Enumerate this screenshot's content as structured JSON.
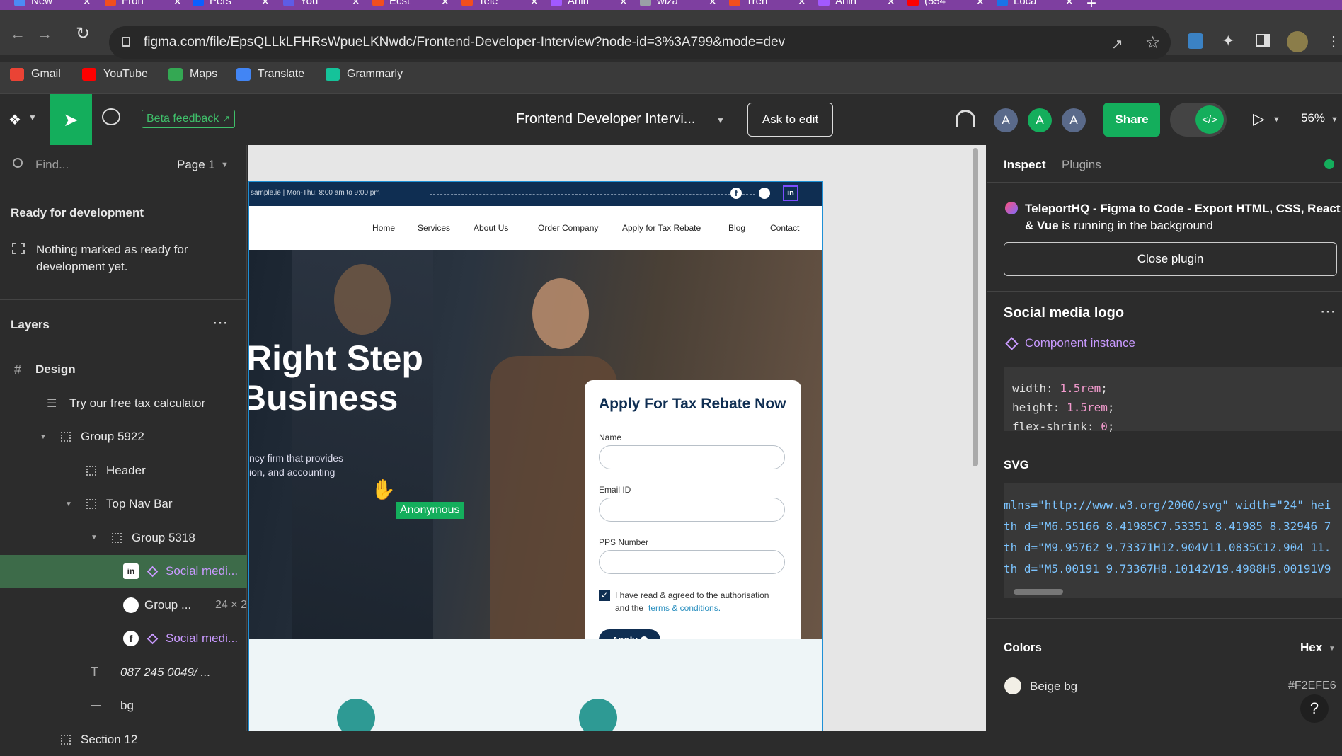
{
  "browser": {
    "tabs": [
      {
        "title": "New",
        "color": "#4c8bf5"
      },
      {
        "title": "Fron",
        "color": "#f24e1e"
      },
      {
        "title": "Pers",
        "color": "#0a5fff"
      },
      {
        "title": "You",
        "color": "#5e5ce6"
      },
      {
        "title": "Ecst",
        "color": "#f24e1e"
      },
      {
        "title": "Tele",
        "color": "#f24e1e"
      },
      {
        "title": "Anin",
        "color": "#a259ff"
      },
      {
        "title": "wiza",
        "color": "#9aa0a6"
      },
      {
        "title": "Tren",
        "color": "#f24e1e"
      },
      {
        "title": "Anin",
        "color": "#a259ff"
      },
      {
        "title": "(554",
        "color": "#ff0000"
      },
      {
        "title": "Loca",
        "color": "#1a73e8"
      }
    ],
    "url": "figma.com/file/EpsQLLkLFHRsWpueLKNwdc/Frontend-Developer-Interview?node-id=3%3A799&mode=dev",
    "bookmarks": [
      {
        "label": "Gmail",
        "color": "#ea4335"
      },
      {
        "label": "YouTube",
        "color": "#ff0000"
      },
      {
        "label": "Maps",
        "color": "#34a853"
      },
      {
        "label": "Translate",
        "color": "#4285f4"
      },
      {
        "label": "Grammarly",
        "color": "#15c39a"
      }
    ]
  },
  "toolbar": {
    "beta_feedback": "Beta feedback",
    "file_title": "Frontend Developer Intervi...",
    "ask_to_edit": "Ask to edit",
    "avatars": [
      {
        "letter": "A",
        "color": "#5a6a8a"
      },
      {
        "letter": "A",
        "color": "#14ae5c"
      },
      {
        "letter": "A",
        "color": "#5a6a8a"
      }
    ],
    "share": "Share",
    "zoom": "56%"
  },
  "left_panel": {
    "find_placeholder": "Find...",
    "page": "Page 1",
    "ready_title": "Ready for development",
    "ready_msg_line1": "Nothing marked as ready for",
    "ready_msg_line2": "development yet.",
    "layers_title": "Layers",
    "layers": [
      {
        "label": "Design",
        "indent": 0
      },
      {
        "label": "Try our free tax calculator",
        "indent": 1
      },
      {
        "label": "Group 5922",
        "indent": 1
      },
      {
        "label": "Header",
        "indent": 2
      },
      {
        "label": "Top Nav Bar",
        "indent": 2
      },
      {
        "label": "Group 5318",
        "indent": 3
      },
      {
        "label": "Social medi...",
        "indent": 4
      },
      {
        "label": "Group ...",
        "indent": 4,
        "extra": "24 × 2..."
      },
      {
        "label": "Social medi...",
        "indent": 4
      },
      {
        "label": "087 245 0049/ ...",
        "indent": 3
      },
      {
        "label": "bg",
        "indent": 3
      },
      {
        "label": "Section 12",
        "indent": 1
      }
    ]
  },
  "canvas": {
    "topbar_text": "sample.ie  |  Mon-Thu: 8:00 am to 9:00 pm",
    "nav_links": [
      "Home",
      "Services",
      "About Us",
      "Order Company",
      "Apply for Tax Rebate",
      "Blog",
      "Contact"
    ],
    "hero_line1": "Right Step",
    "hero_line2": "Business",
    "hero_sub1": "ncy firm that provides",
    "hero_sub2": "ion, and accounting",
    "cursor_label": "Anonymous",
    "form": {
      "title": "Apply For Tax Rebate Now",
      "name_label": "Name",
      "email_label": "Email ID",
      "pps_label": "PPS Number",
      "agree_text1": "I have read & agreed to the authorisation",
      "agree_text2": "and the",
      "agree_link": "terms & conditions.",
      "apply": "Apply"
    }
  },
  "right_panel": {
    "tab_inspect": "Inspect",
    "tab_plugins": "Plugins",
    "plugin_name": "TeleportHQ - Figma to Code - Export HTML, CSS, React",
    "plugin_name2_bold": "& Vue",
    "plugin_name2_rest": " is running in the background",
    "close_plugin": "Close plugin",
    "component_title": "Social media logo",
    "component_kind": "Component instance",
    "css": [
      {
        "prop": "width",
        "val": "1.5rem"
      },
      {
        "prop": "height",
        "val": "1.5rem"
      },
      {
        "prop": "flex-shrink",
        "val": "0"
      }
    ],
    "svg_title": "SVG",
    "svg_lines": [
      "mlns=\"http://www.w3.org/2000/svg\" width=\"24\" hei",
      "th d=\"M6.55166 8.41985C7.53351 8.41985 8.32946 7",
      "th d=\"M9.95762 9.73371H12.904V11.0835C12.904 11.",
      "th d=\"M5.00191 9.73367H8.10142V19.4988H5.00191V9"
    ],
    "colors_title": "Colors",
    "colors_format": "Hex",
    "color_name": "Beige bg",
    "color_hex": "#F2EFE6"
  }
}
